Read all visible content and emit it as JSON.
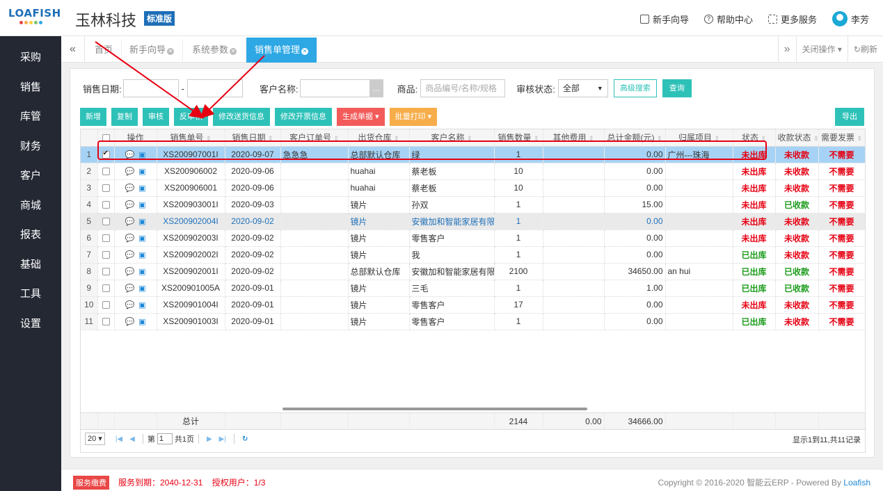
{
  "header": {
    "logo_text": "LOAFISH",
    "company": "玉林科技",
    "edition": "标准版",
    "menu": [
      "新手向导",
      "帮助中心",
      "更多服务"
    ],
    "user": "李芳"
  },
  "sidebar": {
    "items": [
      "采购",
      "销售",
      "库管",
      "财务",
      "客户",
      "商城",
      "报表",
      "基础",
      "工具",
      "设置"
    ]
  },
  "tabs": {
    "items": [
      "首页",
      "新手向导",
      "系统参数",
      "销售单管理"
    ],
    "active": "销售单管理",
    "close_ops": "关闭操作",
    "refresh": "刷新"
  },
  "filters": {
    "date_label": "销售日期:",
    "date_sep": "-",
    "customer_label": "客户名称:",
    "customer_btn": "...",
    "goods_label": "商品:",
    "goods_placeholder": "商品编号/名称/规格",
    "audit_label": "审核状态:",
    "audit_value": "全部",
    "advanced": "高级搜索",
    "query": "查询"
  },
  "toolbar": {
    "add": "新增",
    "copy": "复制",
    "audit": "审核",
    "unaudit": "反审核",
    "edit_ship": "修改送货信息",
    "edit_invoice": "修改开票信息",
    "gen_doc": "生成单据",
    "batch_print": "批量打印",
    "export": "导出"
  },
  "grid": {
    "columns": [
      "操作",
      "销售单号",
      "销售日期",
      "客户订单号",
      "出货仓库",
      "客户名称",
      "销售数量",
      "其他费用",
      "总计金额(元)",
      "归属项目",
      "状态",
      "收款状态",
      "需要发票"
    ],
    "rows": [
      {
        "n": "1",
        "no": "XS200907001I",
        "date": "2020-09-07",
        "cust_order": "急急急",
        "wh": "总部默认仓库",
        "cust": "绿",
        "qty": "1",
        "other": "",
        "total": "0.00",
        "proj": "广州---珠海",
        "status": "未出库",
        "pay": "未收款",
        "inv": "不需要"
      },
      {
        "n": "2",
        "no": "XS200906002",
        "date": "2020-09-06",
        "cust_order": "",
        "wh": "huahai",
        "cust": "蔡老板",
        "qty": "10",
        "other": "",
        "total": "0.00",
        "proj": "",
        "status": "未出库",
        "pay": "未收款",
        "inv": "不需要"
      },
      {
        "n": "3",
        "no": "XS200906001",
        "date": "2020-09-06",
        "cust_order": "",
        "wh": "huahai",
        "cust": "蔡老板",
        "qty": "10",
        "other": "",
        "total": "0.00",
        "proj": "",
        "status": "未出库",
        "pay": "未收款",
        "inv": "不需要"
      },
      {
        "n": "4",
        "no": "XS200903001I",
        "date": "2020-09-03",
        "cust_order": "",
        "wh": "镜片",
        "cust": "孙双",
        "qty": "1",
        "other": "",
        "total": "15.00",
        "proj": "",
        "status": "未出库",
        "pay": "已收款",
        "inv": "不需要"
      },
      {
        "n": "5",
        "no": "XS200902004I",
        "date": "2020-09-02",
        "cust_order": "",
        "wh": "镜片",
        "cust": "安徽加和智能家居有限公",
        "qty": "1",
        "other": "",
        "total": "0.00",
        "proj": "",
        "status": "未出库",
        "pay": "未收款",
        "inv": "不需要"
      },
      {
        "n": "6",
        "no": "XS200902003I",
        "date": "2020-09-02",
        "cust_order": "",
        "wh": "镜片",
        "cust": "零售客户",
        "qty": "1",
        "other": "",
        "total": "0.00",
        "proj": "",
        "status": "未出库",
        "pay": "未收款",
        "inv": "不需要"
      },
      {
        "n": "7",
        "no": "XS200902002I",
        "date": "2020-09-02",
        "cust_order": "",
        "wh": "镜片",
        "cust": "我",
        "qty": "1",
        "other": "",
        "total": "0.00",
        "proj": "",
        "status": "已出库",
        "pay": "未收款",
        "inv": "不需要"
      },
      {
        "n": "8",
        "no": "XS200902001I",
        "date": "2020-09-02",
        "cust_order": "",
        "wh": "总部默认仓库",
        "cust": "安徽加和智能家居有限公",
        "qty": "2100",
        "other": "",
        "total": "34650.00",
        "proj": "an hui",
        "status": "已出库",
        "pay": "已收款",
        "inv": "不需要"
      },
      {
        "n": "9",
        "no": "XS200901005A",
        "date": "2020-09-01",
        "cust_order": "",
        "wh": "镜片",
        "cust": "三毛",
        "qty": "1",
        "other": "",
        "total": "1.00",
        "proj": "",
        "status": "已出库",
        "pay": "已收款",
        "inv": "不需要"
      },
      {
        "n": "10",
        "no": "XS200901004I",
        "date": "2020-09-01",
        "cust_order": "",
        "wh": "镜片",
        "cust": "零售客户",
        "qty": "17",
        "other": "",
        "total": "0.00",
        "proj": "",
        "status": "未出库",
        "pay": "未收款",
        "inv": "不需要"
      },
      {
        "n": "11",
        "no": "XS200901003I",
        "date": "2020-09-01",
        "cust_order": "",
        "wh": "镜片",
        "cust": "零售客户",
        "qty": "1",
        "other": "",
        "total": "0.00",
        "proj": "",
        "status": "已出库",
        "pay": "未收款",
        "inv": "不需要"
      }
    ],
    "totals": {
      "label": "总计",
      "qty": "2144",
      "other": "0.00",
      "total": "34666.00"
    }
  },
  "pager": {
    "page_size": "20",
    "page_prefix": "第",
    "page_value": "1",
    "page_suffix": "共1页",
    "info": "显示1到11,共11记录"
  },
  "footer": {
    "fee": "服务缴费",
    "expire": "服务到期：2040-12-31    授权用户：1/3",
    "copyright": "Copyright © 2016-2020 智能云ERP - Powered By",
    "brand": "Loafish"
  },
  "colors": {
    "accent": "#2ec1b8",
    "active_tab": "#2ea8e5",
    "sidebar": "#232833",
    "red_status": "#e60012",
    "green_status": "#1c9c1c",
    "selected_row": "#a6d3f5"
  }
}
